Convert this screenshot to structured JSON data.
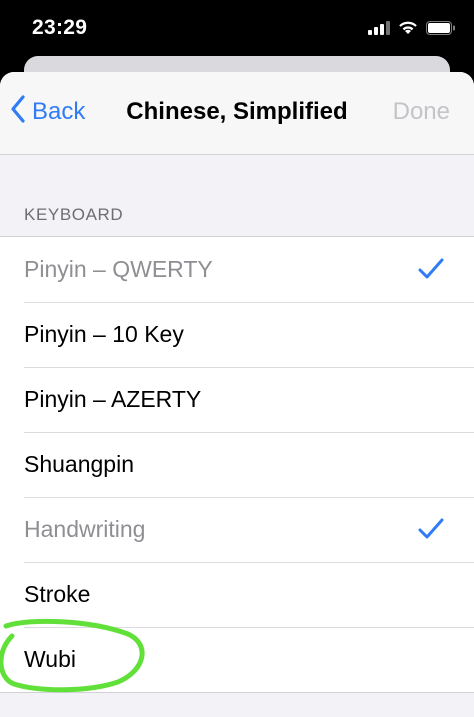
{
  "status_bar": {
    "time": "23:29",
    "icons": [
      "cellular-signal-icon",
      "wifi-icon",
      "battery-icon"
    ]
  },
  "nav": {
    "back_label": "Back",
    "title": "Chinese, Simplified",
    "done_label": "Done"
  },
  "section": {
    "header": "KEYBOARD"
  },
  "keyboards": [
    {
      "label": "Pinyin – QWERTY",
      "checked": true,
      "disabled": true
    },
    {
      "label": "Pinyin – 10 Key",
      "checked": false,
      "disabled": false
    },
    {
      "label": "Pinyin – AZERTY",
      "checked": false,
      "disabled": false
    },
    {
      "label": "Shuangpin",
      "checked": false,
      "disabled": false
    },
    {
      "label": "Handwriting",
      "checked": true,
      "disabled": true
    },
    {
      "label": "Stroke",
      "checked": false,
      "disabled": false
    },
    {
      "label": "Wubi",
      "checked": false,
      "disabled": false
    }
  ],
  "colors": {
    "accent": "#2f7cf6",
    "annotation": "#62e03a",
    "disabled_text": "#8e8e93"
  }
}
